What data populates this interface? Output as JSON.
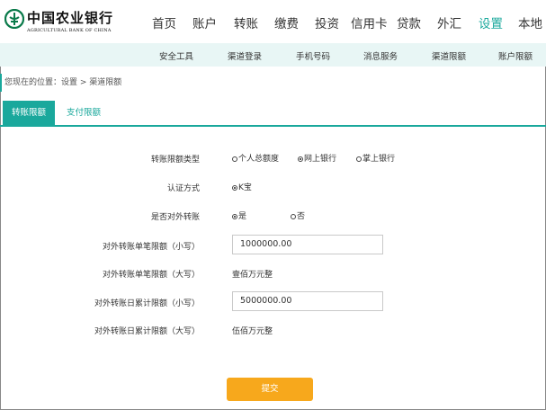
{
  "logo": {
    "cn": "中国农业银行",
    "en": "AGRICULTURAL BANK OF CHINA",
    "color": "#0a7a4a"
  },
  "nav": {
    "items": [
      "首页",
      "账户",
      "转账",
      "缴费",
      "投资",
      "信用卡",
      "贷款",
      "外汇",
      "设置",
      "本地"
    ],
    "active_index": 8
  },
  "subnav": {
    "items": [
      "安全工具",
      "渠道登录",
      "手机号码",
      "消息服务",
      "渠道限额",
      "账户限额"
    ]
  },
  "breadcrumb": "您现在的位置：设置 > 渠道限额",
  "tabs": [
    "转账限额",
    "支付限额"
  ],
  "form": {
    "limit_type": {
      "label": "转账限额类型",
      "options": [
        "个人总额度",
        "网上银行",
        "掌上银行"
      ],
      "selected": 1
    },
    "auth_method": {
      "label": "认证方式",
      "options": [
        "K宝"
      ],
      "selected": 0
    },
    "allow_external": {
      "label": "是否对外转账",
      "options": [
        "是",
        "否"
      ],
      "selected": 0
    },
    "single_limit_small": {
      "label": "对外转账单笔限额（小写）",
      "value": "1000000.00"
    },
    "single_limit_big": {
      "label": "对外转账单笔限额（大写）",
      "value": "壹佰万元整"
    },
    "daily_limit_small": {
      "label": "对外转账日累计限额（小写）",
      "value": "5000000.00"
    },
    "daily_limit_big": {
      "label": "对外转账日累计限额（大写）",
      "value": "伍佰万元整"
    },
    "submit_label": "提交"
  },
  "colors": {
    "accent": "#1aa89c",
    "submit": "#f7a81c",
    "subnav_bg": "#e8f6f5"
  }
}
